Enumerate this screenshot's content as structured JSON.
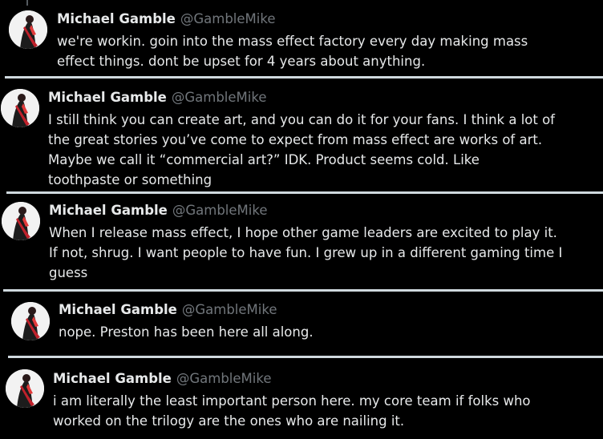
{
  "accent_colors": {
    "background": "#000000",
    "text": "#e7e9ea",
    "handle": "#71767b",
    "divider": "#cfd9de"
  },
  "tweets": [
    {
      "name": "Michael Gamble",
      "handle": "@GambleMike",
      "text": "we're workin. goin into the mass effect factory every day making mass\neffect things. dont be upset for 4 years about anything."
    },
    {
      "name": "Michael Gamble",
      "handle": "@GambleMike",
      "text": "I still think you can create art, and you can do it for your fans. I think a lot of\nthe great stories you’ve come to expect from mass effect are works of art.\nMaybe we call it “commercial art?” IDK. Product seems cold. Like\ntoothpaste or something"
    },
    {
      "name": "Michael Gamble",
      "handle": "@GambleMike",
      "text": "When I release mass effect, I hope other game leaders are excited to play it.\nIf not, shrug. I want people to have fun. I grew up in a different gaming time I\nguess"
    },
    {
      "name": "Michael Gamble",
      "handle": "@GambleMike",
      "text": "nope. Preston has been here all along."
    },
    {
      "name": "Michael Gamble",
      "handle": "@GambleMike",
      "text": "i am literally the least important person here. my core team if folks who\nworked on the trilogy are the ones who are nailing it."
    }
  ]
}
